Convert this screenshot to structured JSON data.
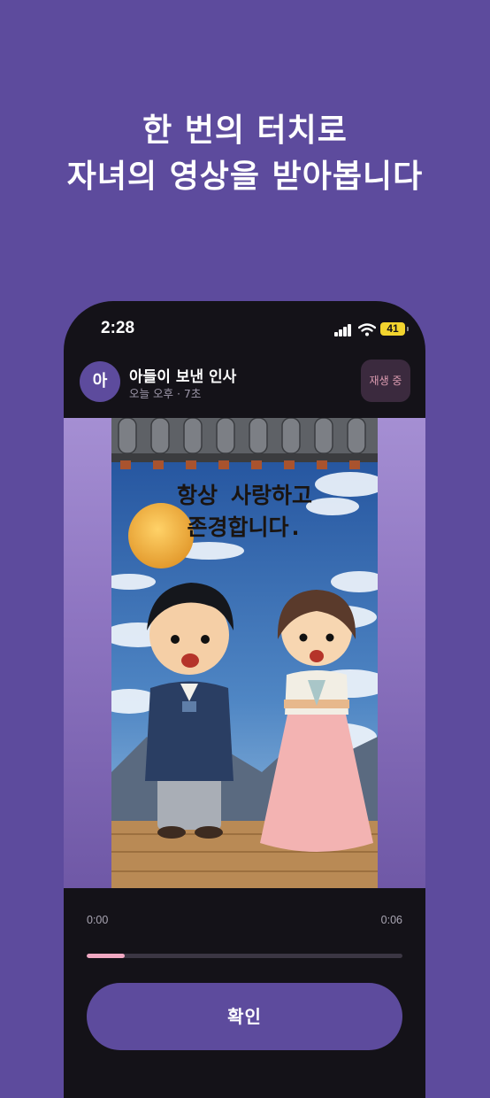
{
  "headline": {
    "line1": "한 번의 터치로",
    "line2": "자녀의 영상을 받아봅니다"
  },
  "status_bar": {
    "time": "2:28",
    "battery": "41",
    "icons": [
      "cellular-signal-icon",
      "wifi-icon",
      "battery-icon"
    ]
  },
  "message": {
    "avatar_initial": "아",
    "title": "아들이 보낸 인사",
    "subtitle": "오늘 오후 · 7초",
    "status_button": "재생 중"
  },
  "video": {
    "caption_line1": "항상 사랑하고",
    "caption_line2": "존경합니다."
  },
  "player": {
    "time_current": "0:00",
    "time_total": "0:06",
    "progress": 0.12
  },
  "confirm_button": "확인",
  "colors": {
    "background": "#5d4b9d",
    "phone": "#141218",
    "accent_pink": "#f0a8c2",
    "battery": "#f2d42e"
  }
}
